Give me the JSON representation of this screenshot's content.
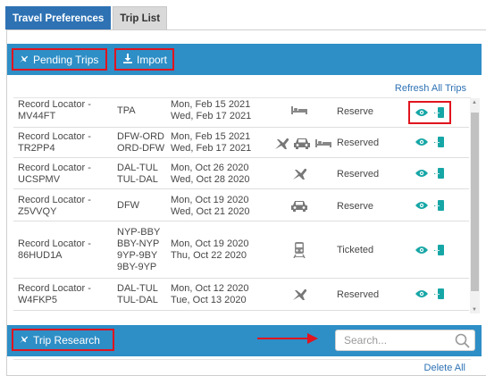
{
  "tabs": [
    {
      "label": "Travel Preferences",
      "active": true
    },
    {
      "label": "Trip List",
      "active": false
    }
  ],
  "pending_trips": {
    "label": "Pending Trips",
    "icon": "plane-icon"
  },
  "import": {
    "label": "Import",
    "icon": "download-icon"
  },
  "refresh_all_trips": "Refresh All Trips",
  "trips": [
    {
      "locator_label": "Record Locator -",
      "locator": "MV44FT",
      "route": [
        "TPA"
      ],
      "dates": [
        "Mon, Feb 15 2021",
        "Wed, Feb 17 2021"
      ],
      "modes": [
        "hotel"
      ],
      "status": "Reserve"
    },
    {
      "locator_label": "Record Locator -",
      "locator": "TR2PP4",
      "route": [
        "DFW-ORD",
        "ORD-DFW"
      ],
      "dates": [
        "Mon, Feb 15 2021",
        "Wed, Feb 17 2021"
      ],
      "modes": [
        "air",
        "car",
        "hotel"
      ],
      "status": "Reserved"
    },
    {
      "locator_label": "Record Locator -",
      "locator": "UCSPMV",
      "route": [
        "DAL-TUL",
        "TUL-DAL"
      ],
      "dates": [
        "Mon, Oct 26 2020",
        "Wed, Oct 28 2020"
      ],
      "modes": [
        "air"
      ],
      "status": "Reserved"
    },
    {
      "locator_label": "Record Locator -",
      "locator": "Z5VVQY",
      "route": [
        "DFW"
      ],
      "dates": [
        "Mon, Oct 19 2020",
        "Wed, Oct 21 2020"
      ],
      "modes": [
        "car"
      ],
      "status": "Reserve"
    },
    {
      "locator_label": "Record Locator -",
      "locator": "86HUD1A",
      "route": [
        "NYP-BBY",
        "BBY-NYP",
        "9YP-9BY",
        "9BY-9YP"
      ],
      "dates": [
        "Mon, Oct 19 2020",
        "Thu, Oct 22 2020"
      ],
      "modes": [
        "rail"
      ],
      "status": "Ticketed"
    },
    {
      "locator_label": "Record Locator -",
      "locator": "W4FKP5",
      "route": [
        "DAL-TUL",
        "TUL-DAL"
      ],
      "dates": [
        "Mon, Oct 12 2020",
        "Tue, Oct 13 2020"
      ],
      "modes": [
        "air"
      ],
      "status": "Reserved"
    }
  ],
  "actions": {
    "view_icon": "eye-icon",
    "export_icon": "export-icon"
  },
  "trip_research": {
    "label": "Trip Research",
    "icon": "plane-icon"
  },
  "search": {
    "placeholder": "Search...",
    "value": ""
  },
  "delete_all": "Delete All",
  "colors": {
    "tab_active": "#2e72b4",
    "section_bar": "#2e8ec6",
    "action_icon": "#17a6a6",
    "highlight": "#e0141e",
    "link": "#2e72b4"
  }
}
